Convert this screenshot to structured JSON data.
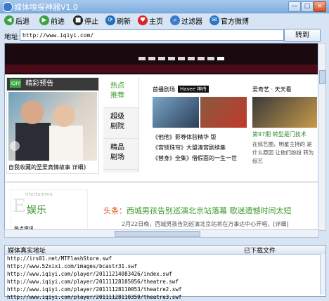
{
  "window": {
    "title": "媒体嗅探神器V1.0",
    "min": "—",
    "max": "□",
    "close": "×"
  },
  "toolbar": [
    {
      "label": "后退",
      "icon": "back-arrow-icon",
      "color": "#3aa142",
      "glyph": "◀"
    },
    {
      "label": "前进",
      "icon": "forward-arrow-icon",
      "color": "#3aa142",
      "glyph": "▶"
    },
    {
      "label": "停止",
      "icon": "stop-icon",
      "color": "#222222",
      "glyph": "■"
    },
    {
      "label": "刷新",
      "icon": "refresh-icon",
      "color": "#1f6dbd",
      "glyph": "⟳"
    },
    {
      "label": "主页",
      "icon": "heart-home-icon",
      "color": "#d9242a",
      "glyph": "♥"
    },
    {
      "label": "过滤器",
      "icon": "magnifier-filter-icon",
      "color": "#3c7ecb",
      "glyph": "⌕"
    },
    {
      "label": "官方微博",
      "icon": "weibo-icon",
      "color": "#2d73c8",
      "glyph": "✉"
    }
  ],
  "address": {
    "label": "地址：",
    "value": "http://www.iqiyi.com/",
    "go_label": "转到"
  },
  "webpage": {
    "preview_title": "精彩预告",
    "preview_logo": "iQIY",
    "preview_caption": "自我收藏的至爱真情故事  详细》",
    "nav": [
      {
        "label": "热点\n推荐",
        "active": true
      },
      {
        "label": "超级\n剧院",
        "active": false
      },
      {
        "label": "精品\n剧场",
        "active": false
      }
    ],
    "col2_title": "首播剧场",
    "col2_brand": "Hasee 神舟",
    "col2_links": [
      "《他他》影尊体验精华 版",
      "《宫锁珠帘》大盟清宫剧续集",
      "《替身》全集》借假面的一生一世"
    ],
    "col3_title": "爱奇艺 · 天天看",
    "col3_sub": "第97期 转型是门技术",
    "col3_desc": "在综艺圈，明星主持的 是什么原因 让他们纷纷 转为综艺",
    "entertainment_en": "ntertainme",
    "entertainment_cn": "娱乐",
    "entertainment_sub": "热点资讯",
    "headline_kw": "头条：",
    "headline": "西城男孩告别巡演北京站落幕 歌迷遗憾时间太短",
    "headline_sub": "2月22日晚，西城男孩告别巡演北京站将在万事达中心开唱，[详细]"
  },
  "dots": [
    false,
    false,
    false,
    false,
    false,
    false,
    false,
    false,
    true
  ],
  "panel": {
    "col1": "媒体真实地址",
    "col2": "已下载文件",
    "rows": [
      "http://irs01.net/MTFlashStore.swf",
      "http://www.52xixi.com/images/bcastr31.swf",
      "http://www.iqiyi.com/player/20111214083426/index.swf",
      "http://www.iqiyi.com/player/20111128105056/theatre.swf",
      "http://www.iqiyi.com/player/20111128110053/theatre2.swf",
      "http://www.iqiyi.com/player/20111128110359/theatre3.swf"
    ]
  }
}
